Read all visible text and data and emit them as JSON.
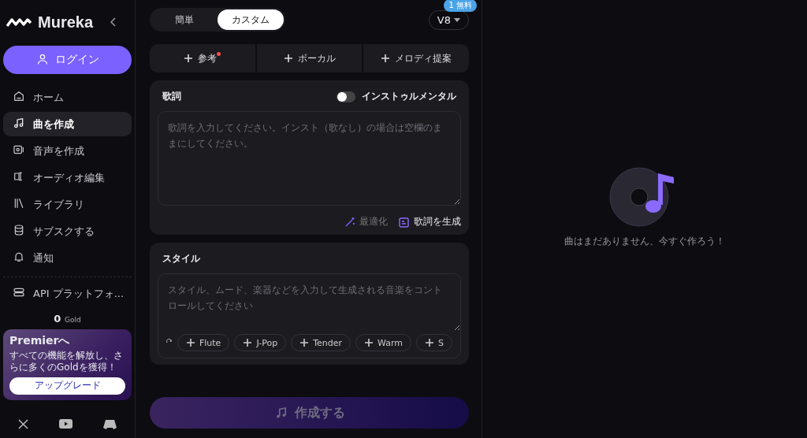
{
  "sidebar": {
    "logo": "Mureka",
    "login_button": "ログイン",
    "items": [
      {
        "label": "ホーム",
        "selected": false
      },
      {
        "label": "曲を作成",
        "selected": true
      },
      {
        "label": "音声を作成",
        "selected": false
      },
      {
        "label": "オーディオ編集",
        "selected": false
      },
      {
        "label": "ライブラリ",
        "selected": false
      },
      {
        "label": "サブスクする",
        "selected": false
      },
      {
        "label": "通知",
        "selected": false
      }
    ],
    "api_item": "API プラットフォ...",
    "gold_amount": "0",
    "gold_unit": "Gold",
    "promo": {
      "title": "Premierへ",
      "text": "すべての機能を解放し、さらに多くのGoldを獲得！",
      "button": "アップグレード"
    }
  },
  "mode_tabs": [
    {
      "label": "簡単",
      "selected": false
    },
    {
      "label": "カスタム",
      "selected": true
    }
  ],
  "model": {
    "value": "V8",
    "badge": "1 無料"
  },
  "add_buttons": [
    {
      "label": "参考",
      "notification": true
    },
    {
      "label": "ボーカル",
      "notification": false
    },
    {
      "label": "メロディ提案",
      "notification": false
    }
  ],
  "lyrics": {
    "title": "歌詞",
    "instrumental_label": "インストゥルメンタル",
    "instrumental_on": false,
    "placeholder": "歌詞を入力してください。インスト（歌なし）の場合は空欄のままにしてください。",
    "optimize_button": "最適化",
    "generate_button": "歌詞を生成"
  },
  "style": {
    "title": "スタイル",
    "placeholder": "スタイル、ムード、楽器などを入力して生成される音楽をコントロールしてください",
    "tags": [
      "Flute",
      "J-Pop",
      "Tender",
      "Warm",
      "S"
    ]
  },
  "create_button": "作成する",
  "empty_state": "曲はまだありません、今すぐ作ろう！"
}
